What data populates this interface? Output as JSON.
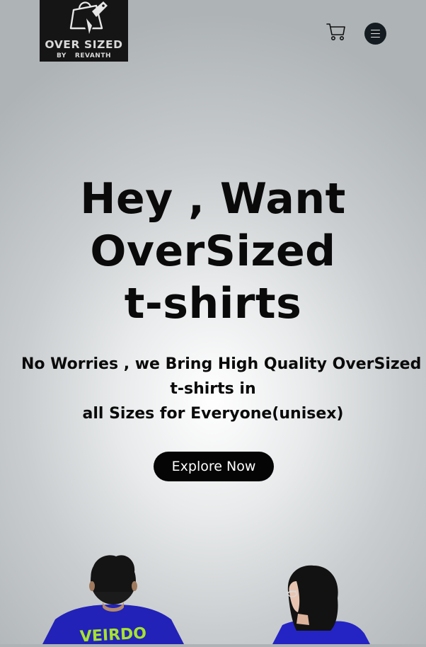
{
  "header": {
    "logo": {
      "title": "OVER SIZED",
      "by": "BY",
      "name": "REVANTH",
      "icon": "shopping-bag-tag-icon"
    },
    "cart_icon": "shopping-cart-icon",
    "menu_icon": "hamburger-menu-icon"
  },
  "hero": {
    "title_lines": [
      "Hey , Want",
      "OverSized",
      "t-shirts"
    ],
    "subtitle_lines": [
      "No Worries , we Bring High Quality OverSized",
      "t-shirts in",
      "all Sizes for Everyone(unisex)"
    ],
    "cta_label": "Explore Now"
  },
  "models": {
    "left_shirt_print": "VEIRDO"
  },
  "colors": {
    "text": "#0a0a0a",
    "button_bg": "#050505",
    "button_text": "#ffffff",
    "logo_bg": "#151515",
    "menu_bg": "#151d22",
    "shirt_blue": "#2222b8",
    "print_green": "#a6e22e"
  }
}
